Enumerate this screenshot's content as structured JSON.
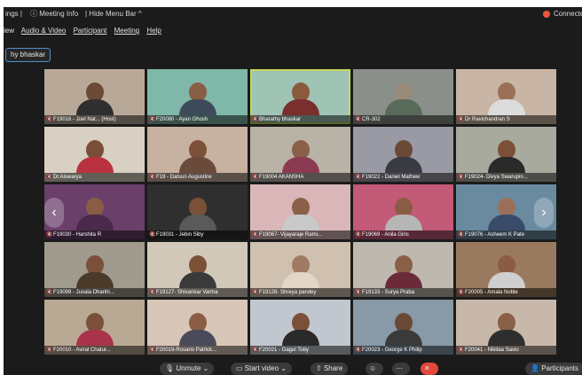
{
  "topbar": {
    "settings_label": "ings |",
    "meeting_info": "Meeting Info",
    "hide_menu": "| Hide Menu Bar ^",
    "connected": "Connecte"
  },
  "menu": {
    "items": [
      {
        "label": "iew"
      },
      {
        "label": "Audio & Video"
      },
      {
        "label": "Participant"
      },
      {
        "label": "Meeting"
      },
      {
        "label": "Help"
      }
    ]
  },
  "speaker_label": "hy bhaskar",
  "tiles": [
    {
      "name": "F19016 - Joel Nat... (Host)",
      "bg": "#b8a898",
      "skin": "#6b4a36",
      "shirt": "#2f2f2f"
    },
    {
      "name": "F20080 - Ayan Ghosh",
      "bg": "#7fb7a8",
      "skin": "#8a5e44",
      "shirt": "#3c4a5a"
    },
    {
      "name": "Bharathy bhaskar",
      "bg": "#9fc3b5",
      "skin": "#8b5a3c",
      "shirt": "#7a2e2e",
      "active": true
    },
    {
      "name": "CR-302",
      "bg": "#8a8f8a",
      "skin": "#9a8a7a",
      "shirt": "#5a6a5a"
    },
    {
      "name": "Dr Ravichandran S",
      "bg": "#c9b5a5",
      "skin": "#9b7056",
      "shirt": "#dcdcdc"
    },
    {
      "name": "Dr.Aiswarya",
      "bg": "#d8d0c2",
      "skin": "#7a4e36",
      "shirt": "#b8323f"
    },
    {
      "name": "F19 - Datsun Augustine",
      "bg": "#c7b2a2",
      "skin": "#7b5238",
      "shirt": "#6a4a3a"
    },
    {
      "name": "F19004 AKANSHA",
      "bg": "#b9b2a6",
      "skin": "#8a5f47",
      "shirt": "#8b3a52"
    },
    {
      "name": "F19022 - Daniel Mathew",
      "bg": "#9a9aa4",
      "skin": "#6a4a36",
      "shirt": "#3a3a42"
    },
    {
      "name": "F19024- Divya Swarupin...",
      "bg": "#a9aa9e",
      "skin": "#7a5037",
      "shirt": "#2a2a2a"
    },
    {
      "name": "F19030 - Harshita R",
      "bg": "#6a3f6a",
      "skin": "#8b5c45",
      "shirt": "#4a2a4a"
    },
    {
      "name": "F19031 - Jebin Siby",
      "bg": "#2f2f2f",
      "skin": "#7a5038",
      "shirt": "#5a5a5a"
    },
    {
      "name": "F19067- Vijayaraje Rami...",
      "bg": "#d9b7b8",
      "skin": "#8b6048",
      "shirt": "#c9c9c9"
    },
    {
      "name": "F19069 - Anila Giris",
      "bg": "#c25a78",
      "skin": "#8a5c44",
      "shirt": "#b6b6b6"
    },
    {
      "name": "F19076 - Asheem K Pate",
      "bg": "#6a8aa0",
      "skin": "#9b7058",
      "shirt": "#3a4a6a"
    },
    {
      "name": "F19099 - Juvala Dhanhi...",
      "bg": "#a19a8e",
      "skin": "#7a5038",
      "shirt": "#4a3a2a"
    },
    {
      "name": "F19127- Shivankar Varma",
      "bg": "#d2c8ba",
      "skin": "#7b5238",
      "shirt": "#3a3a3a"
    },
    {
      "name": "F19128- Shreya pandey",
      "bg": "#cfc0b0",
      "skin": "#a07a62",
      "shirt": "#e2d6c6"
    },
    {
      "name": "F19133 - Surya Praba",
      "bg": "#bfb8ae",
      "skin": "#8a5f47",
      "shirt": "#6a2a3a"
    },
    {
      "name": "F20005 - Amala Noble",
      "bg": "#9a7a5e",
      "skin": "#8b5c45",
      "shirt": "#cfcfcf"
    },
    {
      "name": "F20010 - Aviral Chatur...",
      "bg": "#b9a893",
      "skin": "#7a5038",
      "shirt": "#a9334a"
    },
    {
      "name": "F20019-Rosario Patrick...",
      "bg": "#d8c6b8",
      "skin": "#8a5e44",
      "shirt": "#4a4a5a"
    },
    {
      "name": "F20021 - Gagul Toby",
      "bg": "#c1c7cf",
      "skin": "#7a5038",
      "shirt": "#2a2a2a"
    },
    {
      "name": "F20023 - George K Philip",
      "bg": "#8899a8",
      "skin": "#6a4a36",
      "shirt": "#3a3a3a"
    },
    {
      "name": "F20041 - Nikitaa Savio",
      "bg": "#c7b8aa",
      "skin": "#8a5f47",
      "shirt": "#2e2e2e"
    }
  ],
  "controls": {
    "unmute": "Unmute",
    "start_video": "Start video",
    "share": "Share",
    "participants": "Participants"
  }
}
